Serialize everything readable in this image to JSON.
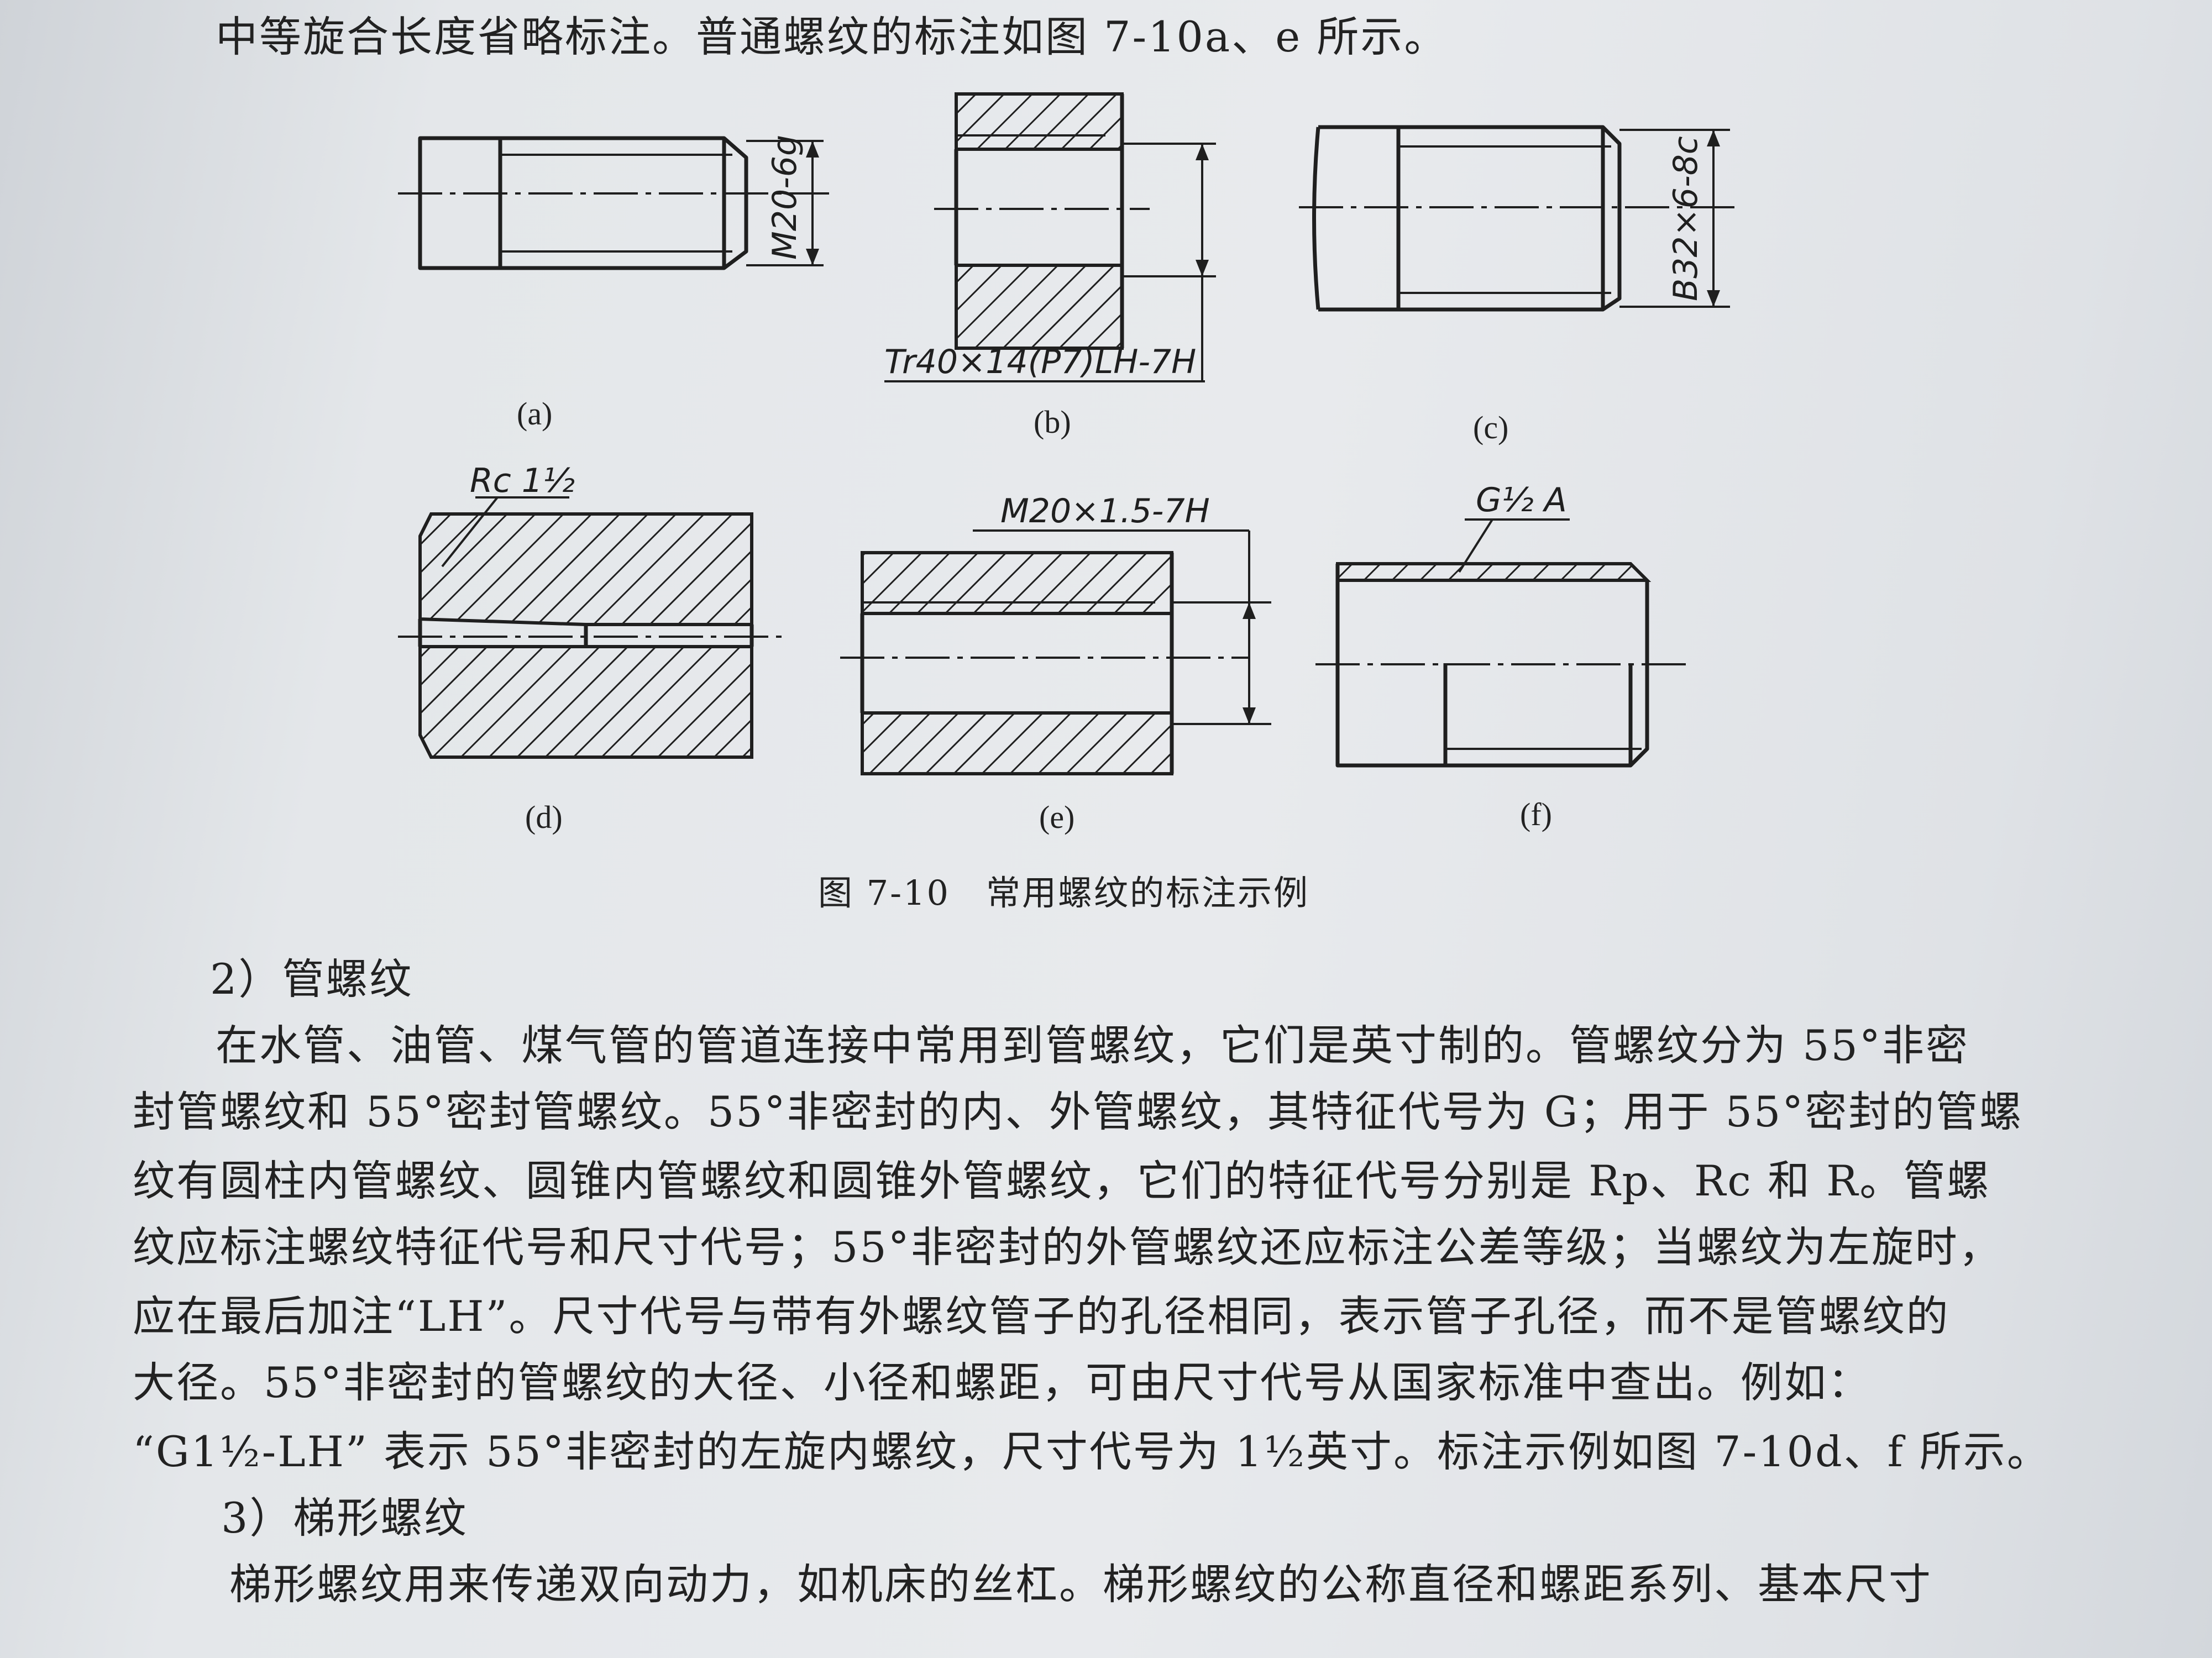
{
  "top_line": "中等旋合长度省略标注。普通螺纹的标注如图 7-10a、e 所示。",
  "figures": {
    "a": {
      "sub": "(a)",
      "label": "M20-6g"
    },
    "b": {
      "sub": "(b)",
      "label": "Tr40×14(P7)LH-7H"
    },
    "c": {
      "sub": "(c)",
      "label": "B32×6-8c"
    },
    "d": {
      "sub": "(d)",
      "label": "Rc 1½"
    },
    "e": {
      "sub": "(e)",
      "label": "M20×1.5-7H"
    },
    "f": {
      "sub": "(f)",
      "label": "G½ A"
    }
  },
  "figure_title": "图 7-10　常用螺纹的标注示例",
  "section_pipe": "2）管螺纹",
  "paragraph_pipe": [
    "在水管、油管、煤气管的管道连接中常用到管螺纹，它们是英寸制的。管螺纹分为 55°非密",
    "封管螺纹和 55°密封管螺纹。55°非密封的内、外管螺纹，其特征代号为 G；用于 55°密封的管螺",
    "纹有圆柱内管螺纹、圆锥内管螺纹和圆锥外管螺纹，它们的特征代号分别是 Rp、Rc 和 R。管螺",
    "纹应标注螺纹特征代号和尺寸代号；55°非密封的外管螺纹还应标注公差等级；当螺纹为左旋时，",
    "应在最后加注“LH”。尺寸代号与带有外螺纹管子的孔径相同，表示管子孔径，而不是管螺纹的",
    "大径。55°非密封的管螺纹的大径、小径和螺距，可由尺寸代号从国家标准中查出。例如：",
    "“G1½-LH” 表示 55°非密封的左旋内螺纹，尺寸代号为 1½英寸。标注示例如图 7-10d、f 所示。"
  ],
  "section_trap": "3）梯形螺纹",
  "paragraph_trap": [
    "梯形螺纹用来传递双向动力，如机床的丝杠。梯形螺纹的公称直径和螺距系列、基本尺寸"
  ]
}
